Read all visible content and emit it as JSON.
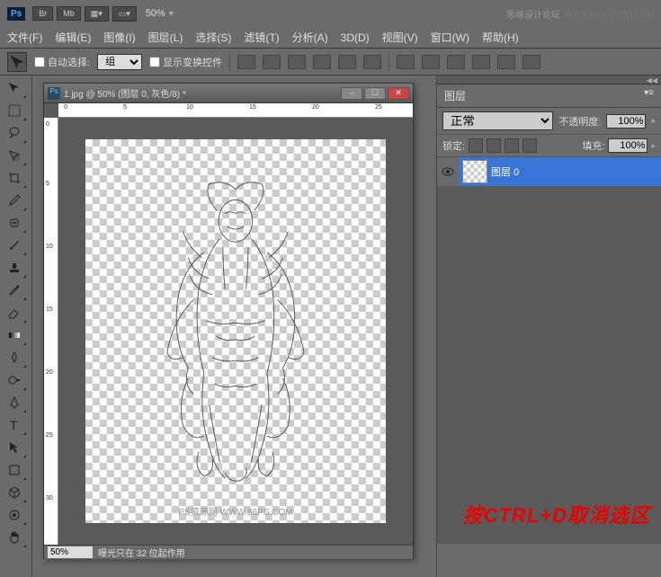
{
  "header": {
    "ps_logo": "Ps",
    "btn_br": "Br",
    "btn_mb": "Mb",
    "zoom": "50%",
    "watermark": "思缘设计论坛",
    "watermark_url": "WWW.MISSYUAN.COM"
  },
  "menu": {
    "file": "文件(F)",
    "edit": "编辑(E)",
    "image": "图像(I)",
    "layer": "图层(L)",
    "select": "选择(S)",
    "filter": "滤镜(T)",
    "analysis": "分析(A)",
    "3d": "3D(D)",
    "view": "视图(V)",
    "window": "窗口(W)",
    "help": "帮助(H)"
  },
  "options": {
    "auto_select": "自动选择:",
    "group": "组",
    "show_transform": "显示变换控件"
  },
  "document": {
    "title": "1.jpg @ 50% (图层 0, 灰色/8) *",
    "ruler_h": [
      "0",
      "5",
      "10",
      "15",
      "20",
      "25"
    ],
    "ruler_v": [
      "0",
      "5",
      "10",
      "15",
      "20",
      "25",
      "30"
    ],
    "canvas_watermark": "PS资源网   WWW.86PS.COM",
    "status_zoom": "50%",
    "status_text": "曝光只在 32 位起作用"
  },
  "panels": {
    "layers_tab": "图层",
    "blend_mode": "正常",
    "opacity_label": "不透明度:",
    "opacity_value": "100%",
    "lock_label": "锁定:",
    "fill_label": "填充:",
    "fill_value": "100%",
    "layer0_name": "图层 0"
  },
  "annotation": "按CTRL+D取消选区"
}
